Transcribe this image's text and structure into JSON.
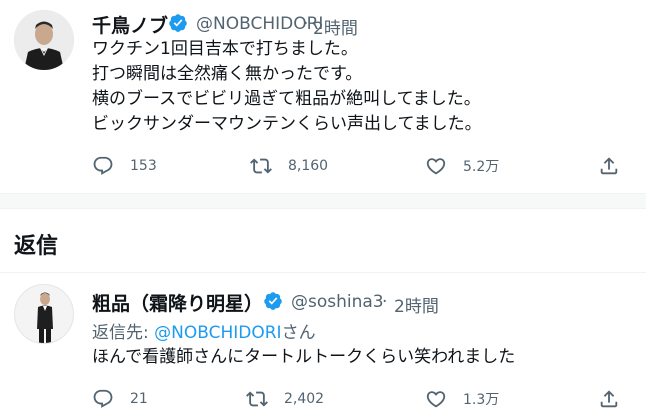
{
  "main_tweet": {
    "author_name": "千鳥ノブ",
    "author_handle": "@NOBCHIDORI",
    "separator": "·",
    "time": "2時間",
    "lines": [
      "ワクチン1回目吉本で打ちました。",
      "打つ瞬間は全然痛く無かったです。",
      "横のブースでビビリ過ぎて粗品が絶叫してました。",
      "ビックサンダーマウンテンくらい声出してました。"
    ],
    "stats": {
      "replies": "153",
      "retweets": "8,160",
      "likes": "5.2万"
    }
  },
  "replies_heading": "返信",
  "reply_tweet": {
    "author_name": "粗品（霜降り明星）",
    "author_handle": "@soshina3",
    "separator": "·",
    "time": "2時間",
    "replying_prefix": "返信先: ",
    "replying_mention": "@NOBCHIDORI",
    "replying_suffix": "さん",
    "text": "ほんで看護師さんにタートルトークくらい笑われました",
    "stats": {
      "replies": "21",
      "retweets": "2,402",
      "likes": "1.3万"
    }
  },
  "colors": {
    "accent": "#1d9bf0",
    "muted": "#536471",
    "text": "#0f1419",
    "verified": "#1d9bf0"
  },
  "icons": {
    "reply": "reply-icon",
    "retweet": "retweet-icon",
    "like": "heart-icon",
    "share": "share-icon",
    "verified": "verified-badge-icon"
  }
}
